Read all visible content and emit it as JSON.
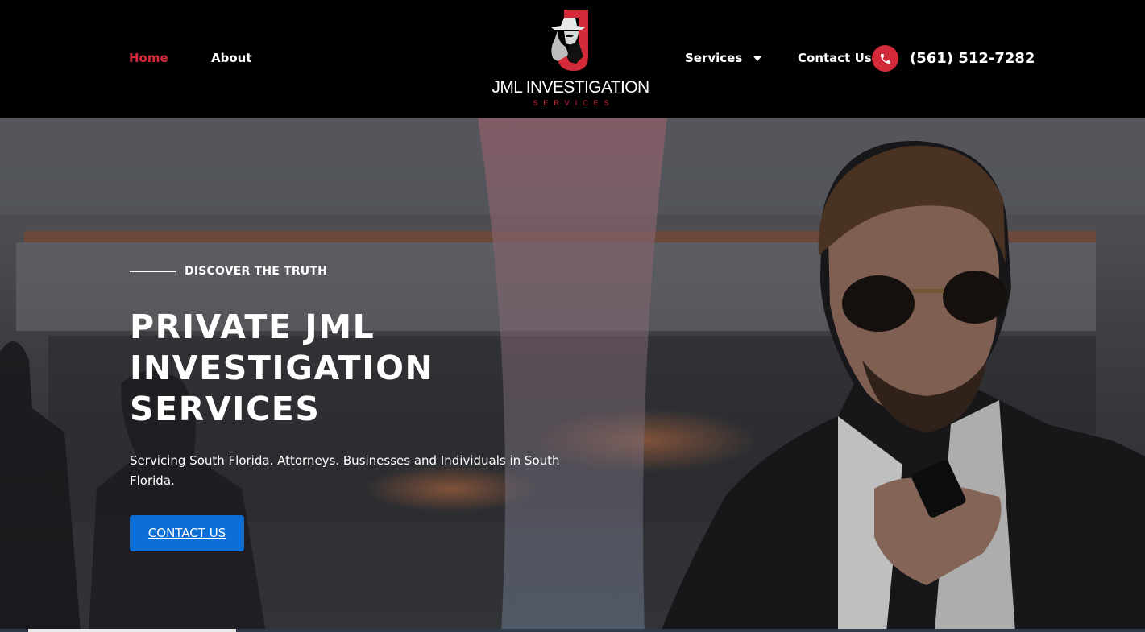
{
  "nav": {
    "home": "Home",
    "about": "About",
    "services": "Services",
    "contact": "Contact Us",
    "phone": "(561) 512-7282"
  },
  "logo": {
    "name": "JML INVESTIGATION",
    "tagline": "SERVICES"
  },
  "hero": {
    "eyebrow": "DISCOVER THE TRUTH",
    "title": "PRIVATE JML INVESTIGATION SERVICES",
    "subtitle": "Servicing South Florida. Attorneys. Businesses and Individuals in South Florida.",
    "cta": "CONTACT US"
  },
  "colors": {
    "accent": "#d32a3a",
    "cta": "#0b6fd6",
    "header_bg": "#000000"
  },
  "icons": {
    "phone": "phone-icon",
    "services_caret": "caret-down-icon",
    "logo_mark": "detective-j-logo"
  }
}
